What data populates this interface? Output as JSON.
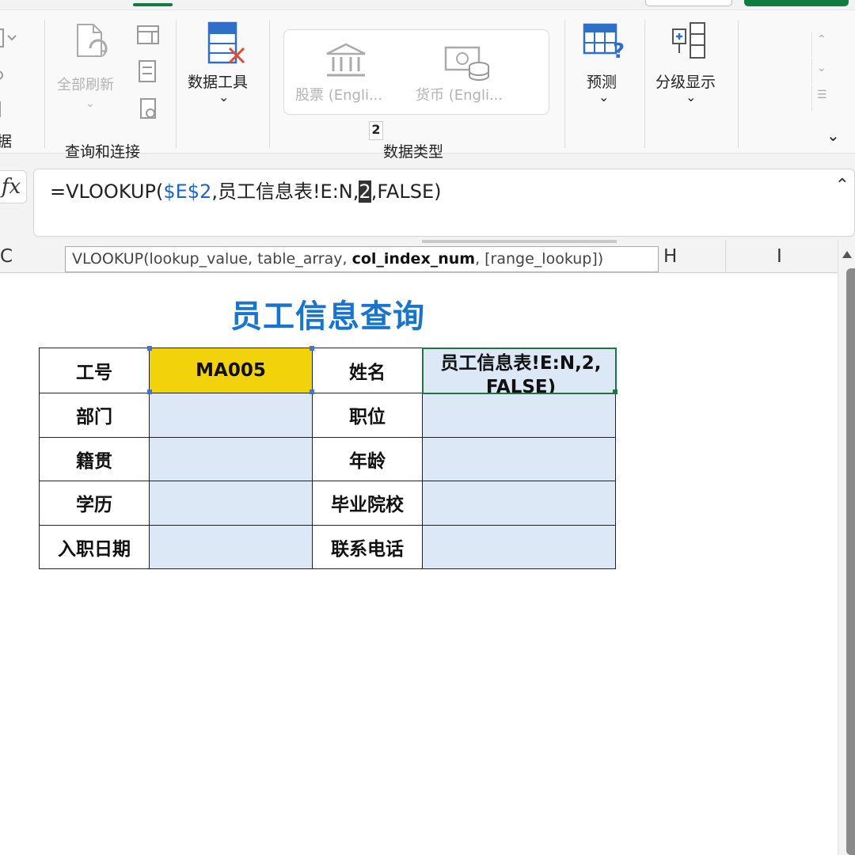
{
  "ribbon": {
    "partial_group_label": "据",
    "query": {
      "refresh_all_label": "全部刷新",
      "group_label": "查询和连接"
    },
    "data_tools": {
      "label": "数据工具"
    },
    "data_types": {
      "stocks_label": "股票 (Engli...",
      "currency_label": "货币 (Engli...",
      "group_label": "数据类型",
      "key_tip": "2"
    },
    "forecast": {
      "label": "预测"
    },
    "outline": {
      "label": "分级显示"
    }
  },
  "formula_bar": {
    "fx_label": "fx",
    "formula_prefix": "=VLOOKUP(",
    "formula_ref": "$E$2",
    "formula_mid": ",员工信息表!E:N,",
    "formula_cursor": "2",
    "formula_suffix": ",FALSE)"
  },
  "columns": {
    "c": "C",
    "h": "H",
    "i": "I"
  },
  "tooltip": {
    "prefix": "VLOOKUP(lookup_value, table_array, ",
    "bold_arg": "col_index_num",
    "suffix": ", [range_lookup])"
  },
  "sheet": {
    "title": "员工信息查询",
    "rows": [
      {
        "label1": "工号",
        "value1": "MA005",
        "label2": "姓名",
        "value2": "员工信息表!E:N,2,\nFALSE)"
      },
      {
        "label1": "部门",
        "value1": "",
        "label2": "职位",
        "value2": ""
      },
      {
        "label1": "籍贯",
        "value1": "",
        "label2": "年龄",
        "value2": ""
      },
      {
        "label1": "学历",
        "value1": "",
        "label2": "毕业院校",
        "value2": ""
      },
      {
        "label1": "入职日期",
        "value1": "",
        "label2": "联系电话",
        "value2": ""
      }
    ]
  },
  "colors": {
    "accent_green": "#107c41",
    "title_blue": "#1874cd",
    "key_cell_yellow": "#f2d20a",
    "value_cell_blue": "#dce8f6",
    "reference_blue": "#1f64c8"
  },
  "icons": [
    "refresh-icon",
    "data-tools-icon",
    "bank-icon",
    "currency-icon",
    "forecast-icon",
    "outline-icon",
    "expand-ribbon-icon"
  ]
}
